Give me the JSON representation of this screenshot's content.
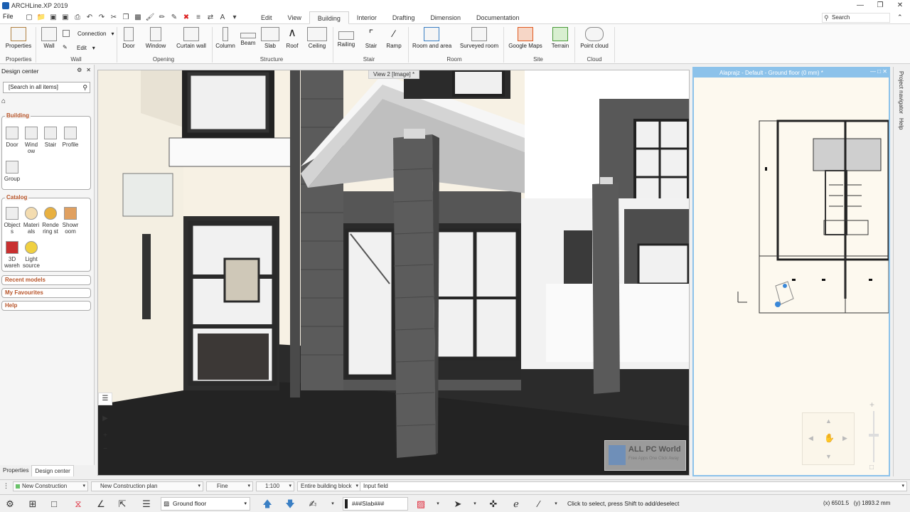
{
  "window": {
    "title": "ARCHLine.XP 2019"
  },
  "menu": {
    "file": "File",
    "tabs": [
      "Edit",
      "View",
      "Building",
      "Interior",
      "Drafting",
      "Dimension",
      "Documentation"
    ],
    "active_tab": "Building",
    "search_placeholder": "Search"
  },
  "ribbon": {
    "buttons": {
      "properties": "Properties",
      "wall": "Wall",
      "connection": "Connection",
      "edit": "Edit",
      "door": "Door",
      "window": "Window",
      "curtain_wall": "Curtain wall",
      "column": "Column",
      "beam": "Beam",
      "slab": "Slab",
      "roof": "Roof",
      "ceiling": "Ceiling",
      "railing": "Railing",
      "stair": "Stair",
      "ramp": "Ramp",
      "room_and_area": "Room and area",
      "surveyed_room": "Surveyed room",
      "google_maps": "Google Maps",
      "terrain": "Terrain",
      "point_cloud": "Point cloud"
    },
    "groups": {
      "properties": "Properties",
      "wall": "Wall",
      "opening": "Opening",
      "structure": "Structure",
      "stair": "Stair",
      "room": "Room",
      "site": "Site",
      "cloud": "Cloud"
    }
  },
  "design_center": {
    "title": "Design center",
    "search_placeholder": "[Search in all items]",
    "building": {
      "header": "Building",
      "items": [
        "Door",
        "Wind ow",
        "Stair",
        "Profile",
        "Group"
      ]
    },
    "catalog": {
      "header": "Catalog",
      "items": [
        "Object s",
        "Materi als",
        "Rende ring st",
        "Showr oom",
        "3D wareh",
        "Light source"
      ]
    },
    "recent_models": "Recent models",
    "my_favourites": "My Favourites",
    "help": "Help"
  },
  "bottom_tabs": [
    "Properties",
    "Design center"
  ],
  "views": {
    "view3d_title": "View 2 [Image] *",
    "plan_title": "Alaprajz - Default - Ground floor (0 mm) *"
  },
  "right_tabs": [
    "Project navigator",
    "Help"
  ],
  "watermark": {
    "title": "ALL PC World",
    "subtitle": "Free Apps One Click Away"
  },
  "status1": {
    "construction": "New Construction",
    "construction_plan": "New Construction plan",
    "quality": "Fine",
    "scale": "1:100",
    "block": "Entire building block",
    "input_field": "Input field"
  },
  "status2": {
    "floor": "Ground floor",
    "slab": "###Slab###",
    "message": "Click to select, press Shift to add/deselect",
    "x": "(x) 6501.5",
    "y": "(y) 1893.2 mm"
  }
}
